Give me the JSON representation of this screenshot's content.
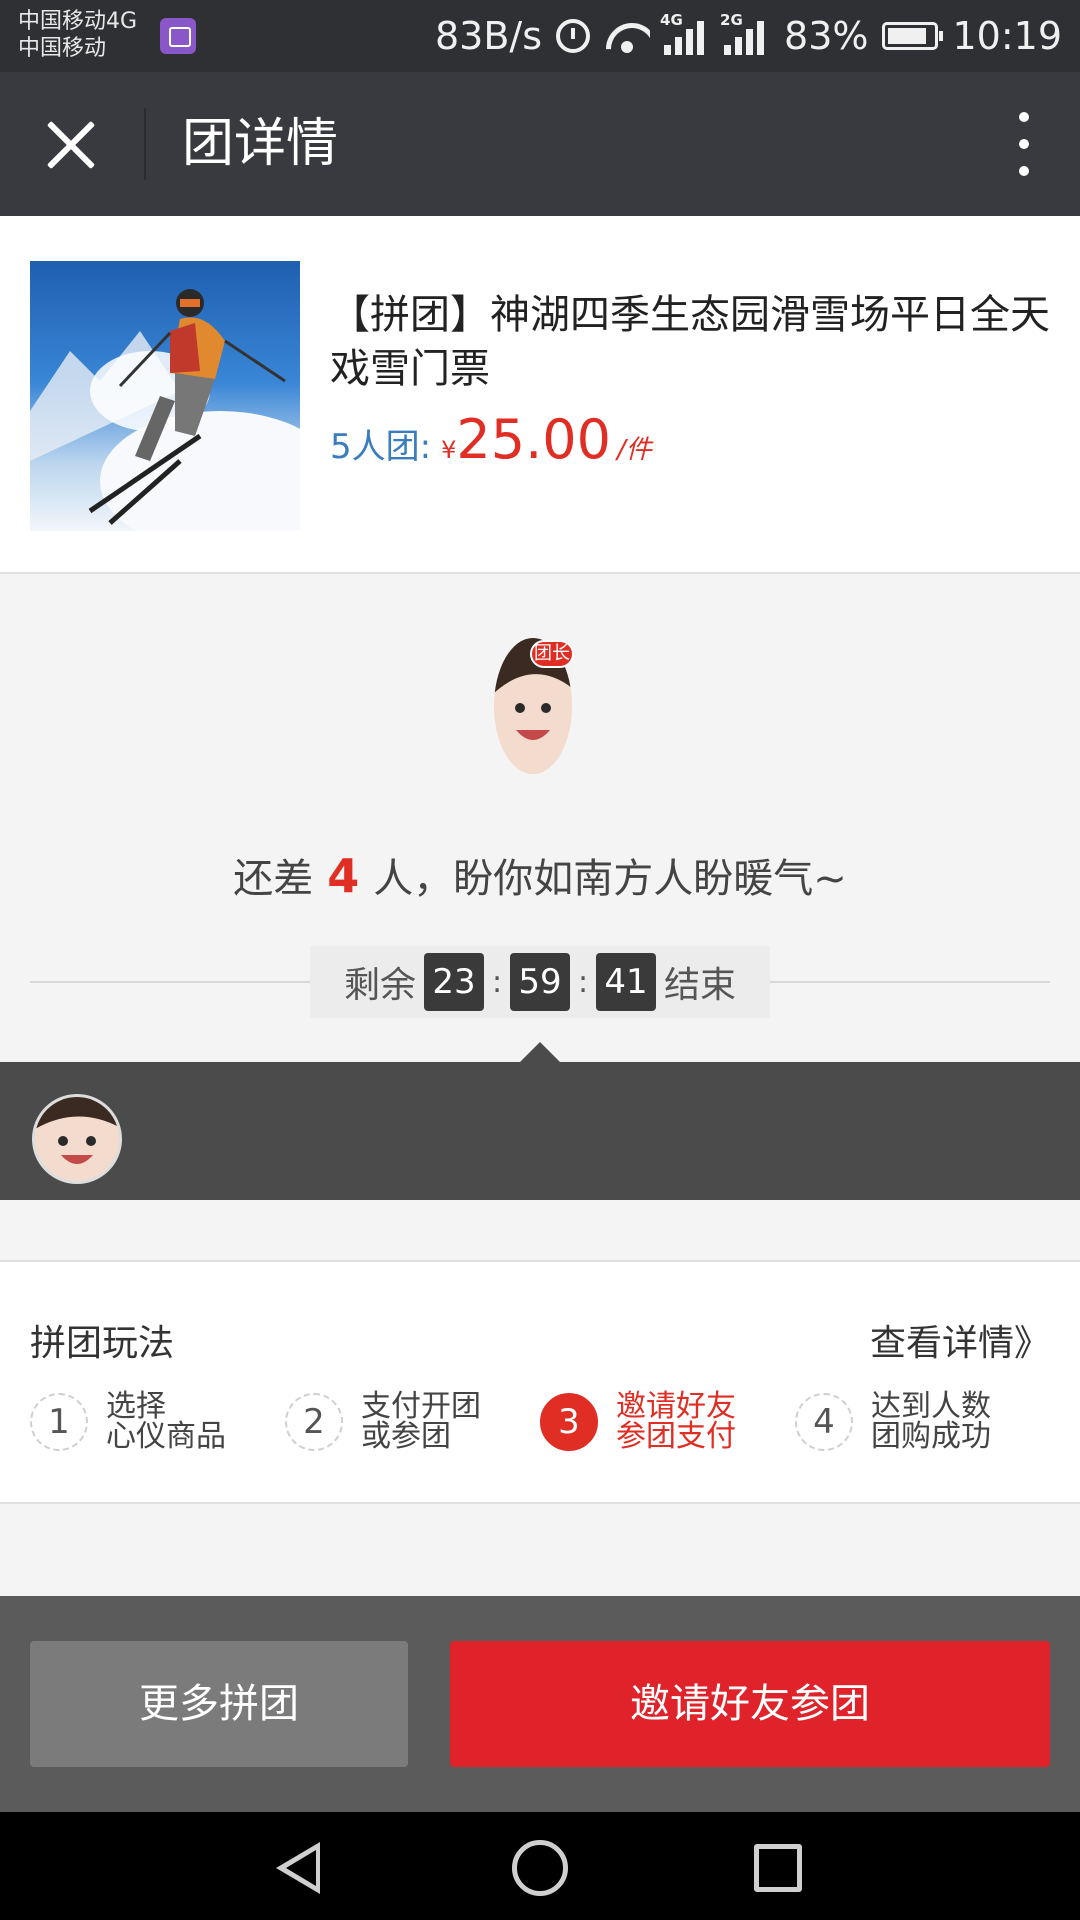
{
  "status_bar": {
    "carrier_1": "中国移动4G",
    "carrier_2": "中国移动",
    "speed": "83B/s",
    "signal_1_label": "4G",
    "signal_2_label": "2G",
    "battery": "83%",
    "time": "10:19"
  },
  "header": {
    "title": "团详情"
  },
  "product": {
    "title": "【拼团】神湖四季生态园滑雪场平日全天戏雪门票",
    "group_label": "5人团:",
    "currency": "¥",
    "price": "25.00",
    "unit": "/件"
  },
  "team": {
    "leader_badge": "团长",
    "need_prefix": "还差",
    "need_count": "4",
    "need_suffix": "人，盼你如南方人盼暖气~",
    "countdown": {
      "prefix": "剩余",
      "hours": "23",
      "minutes": "59",
      "seconds": "41",
      "separator": ":",
      "suffix": "结束"
    }
  },
  "rules": {
    "title": "拼团玩法",
    "detail_link": "查看详情》",
    "steps": [
      {
        "num": "1",
        "line1": "选择",
        "line2": "心仪商品"
      },
      {
        "num": "2",
        "line1": "支付开团",
        "line2": "或参团"
      },
      {
        "num": "3",
        "line1": "邀请好友",
        "line2": "参团支付"
      },
      {
        "num": "4",
        "line1": "达到人数",
        "line2": "团购成功"
      }
    ]
  },
  "actions": {
    "more_groups": "更多拼团",
    "invite_friends": "邀请好友参团"
  },
  "colors": {
    "accent_red": "#e02e24",
    "title_bar": "#393a3f",
    "group_label_blue": "#3a7dbf"
  }
}
